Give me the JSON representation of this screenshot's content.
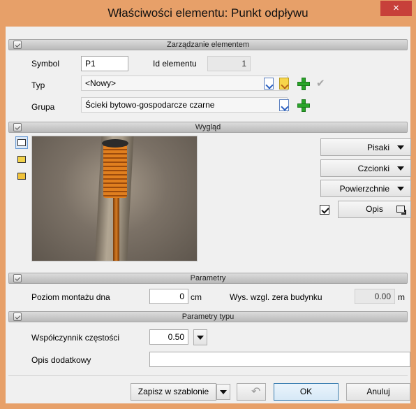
{
  "window": {
    "title": "Właściwości elementu: Punkt odpływu",
    "close": "×"
  },
  "sections": {
    "management": "Zarządzanie elementem",
    "appearance": "Wygląd",
    "parameters": "Parametry",
    "type_parameters": "Parametry typu"
  },
  "management": {
    "symbol_label": "Symbol",
    "symbol_value": "P1",
    "id_label": "Id elementu",
    "id_value": "1",
    "type_label": "Typ",
    "type_value": "<Nowy>",
    "group_label": "Grupa",
    "group_value": "Ścieki bytowo-gospodarcze czarne"
  },
  "appearance": {
    "pens_label": "Pisaki",
    "fonts_label": "Czcionki",
    "surfaces_label": "Powierzchnie",
    "description_label": "Opis",
    "description_checked": true
  },
  "parameters": {
    "mount_level_label": "Poziom montażu dna",
    "mount_level_value": "0",
    "mount_level_unit": "cm",
    "height_label": "Wys. wzgl. zera budynku",
    "height_value": "0.00",
    "height_unit": "m"
  },
  "type_parameters": {
    "frequency_label": "Współczynnik częstości",
    "frequency_value": "0.50",
    "extra_desc_label": "Opis dodatkowy",
    "extra_desc_value": ""
  },
  "footer": {
    "save_template_label": "Zapisz w szablonie",
    "ok_label": "OK",
    "cancel_label": "Anuluj"
  }
}
